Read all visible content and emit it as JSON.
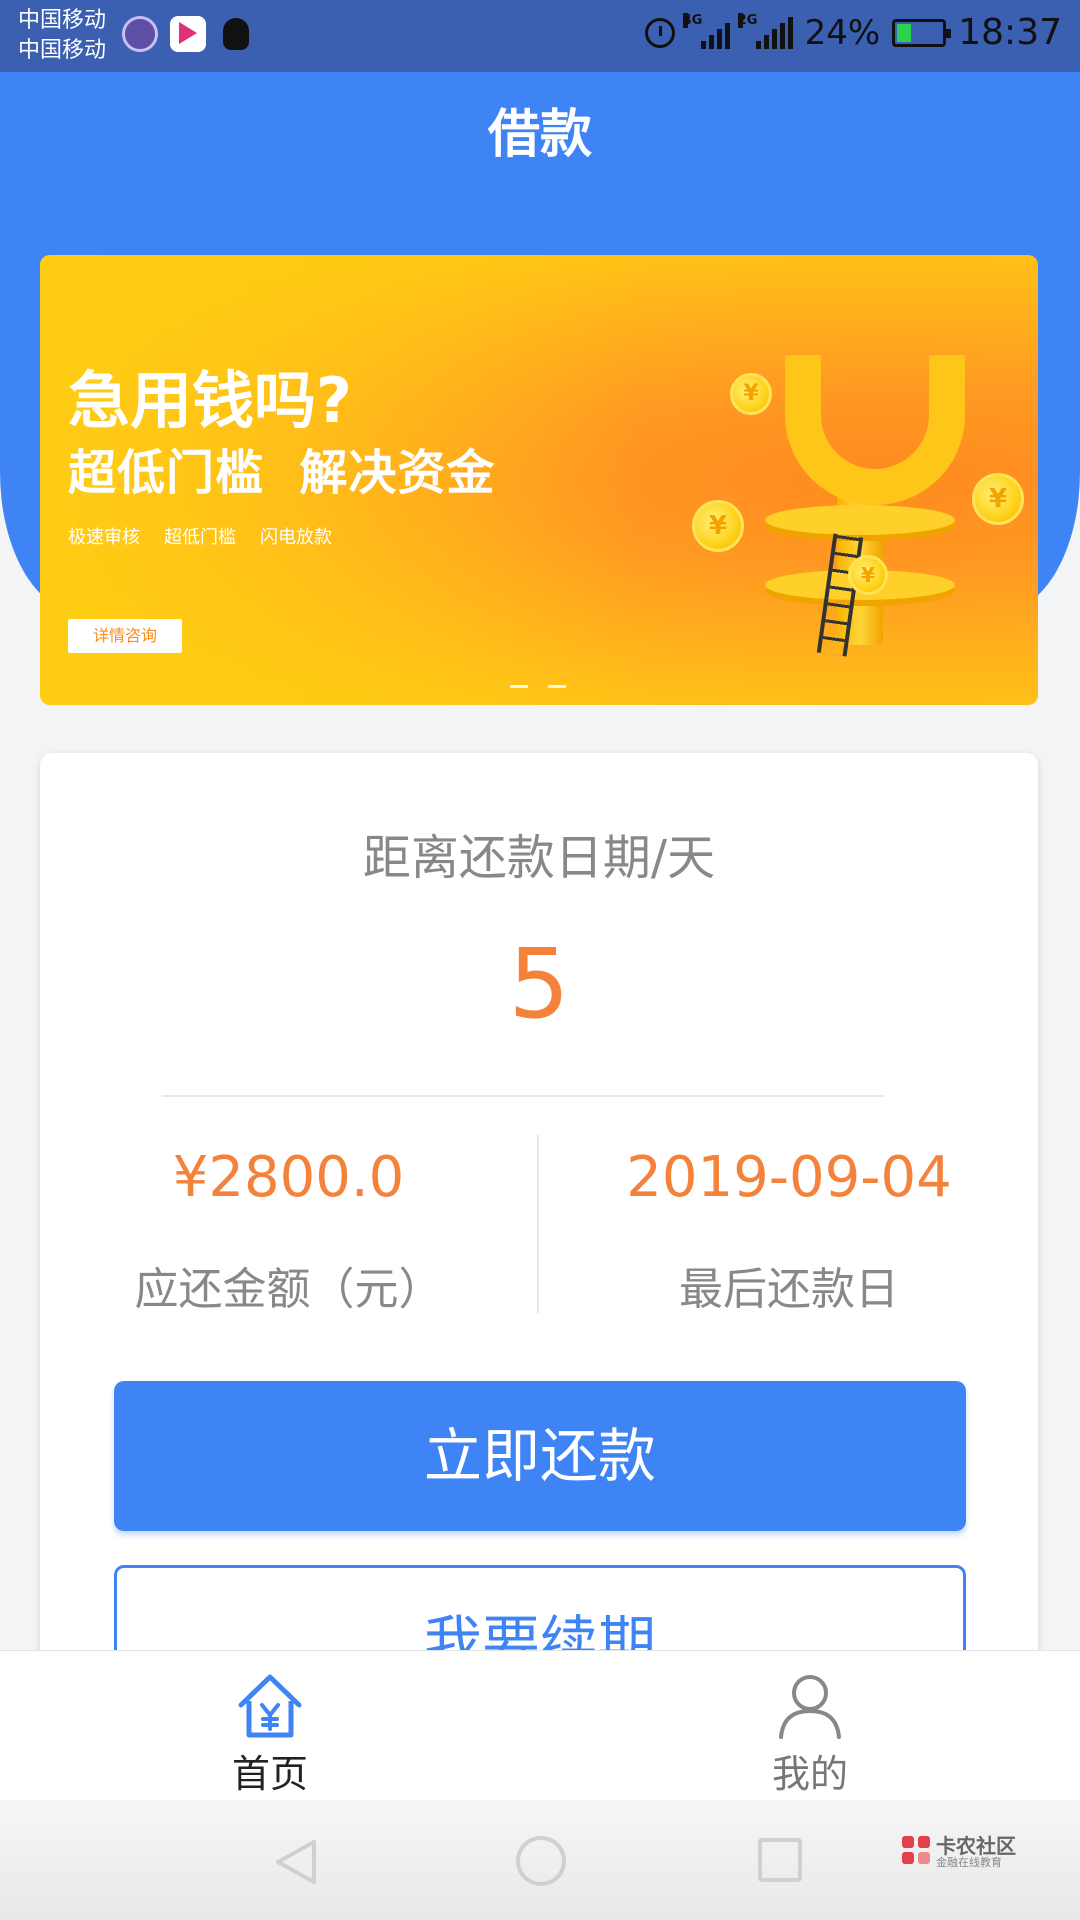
{
  "status_bar": {
    "carrier_1": "中国移动",
    "carrier_2": "中国移动",
    "network_1": "4G",
    "network_2": "2G",
    "battery_percent": "24%",
    "time": "18:37"
  },
  "header": {
    "title": "借款"
  },
  "banner": {
    "title": "急用钱吗?",
    "subtitle": "超低门槛  解决资金",
    "tags": [
      "极速审核",
      "超低门槛",
      "闪电放款"
    ],
    "button_label": "详情咨询",
    "coin_symbol": "¥",
    "page_count": 2
  },
  "repayment": {
    "countdown_label": "距离还款日期/天",
    "countdown_value": "5",
    "amount_value": "¥2800.0",
    "amount_label": "应还金额（元）",
    "due_date_value": "2019-09-04",
    "due_date_label": "最后还款日",
    "repay_button": "立即还款",
    "renew_button": "我要续期"
  },
  "tabs": [
    {
      "label": "首页",
      "icon": "home-yen-icon",
      "active": true
    },
    {
      "label": "我的",
      "icon": "user-icon",
      "active": false
    }
  ],
  "watermark": {
    "name": "卡农社区",
    "sub": "金融在线教育"
  },
  "colors": {
    "primary": "#3f84f4",
    "accent_orange": "#f5823a",
    "banner_yellow": "#ffc714",
    "text_gray": "#888888"
  }
}
